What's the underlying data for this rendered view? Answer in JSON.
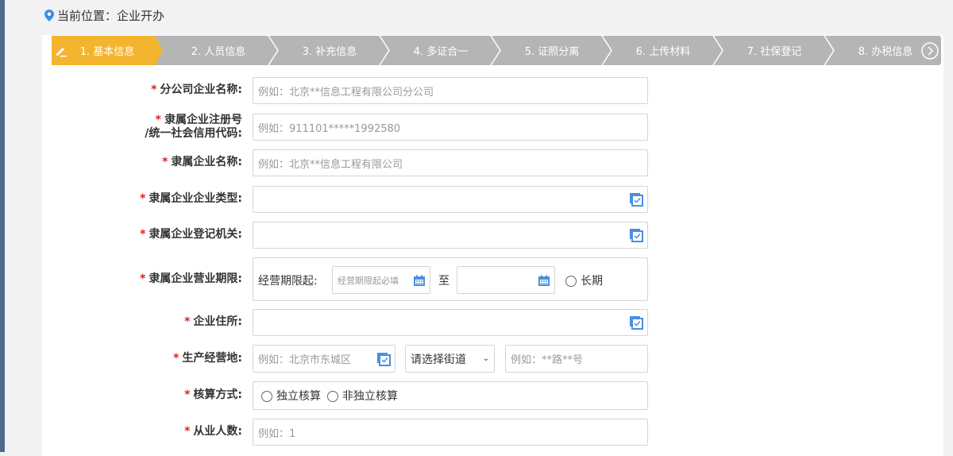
{
  "breadcrumb": {
    "text": "当前位置：企业开办"
  },
  "steps": [
    "1. 基本信息",
    "2. 人员信息",
    "3. 补充信息",
    "4. 多证合一",
    "5. 证照分离",
    "6. 上传材料",
    "7. 社保登记",
    "8. 办税信息"
  ],
  "form": {
    "branch_name": {
      "label": "分公司企业名称:",
      "placeholder": "例如：北京**信息工程有限公司分公司"
    },
    "parent_reg": {
      "label1": "隶属企业注册号",
      "label2": "/统一社会信用代码:",
      "placeholder": "例如：911101*****1992580"
    },
    "parent_name": {
      "label": "隶属企业名称:",
      "placeholder": "例如：北京**信息工程有限公司"
    },
    "parent_type": {
      "label": "隶属企业企业类型:"
    },
    "parent_authority": {
      "label": "隶属企业登记机关:"
    },
    "parent_term": {
      "label": "隶属企业营业期限:",
      "start_label": "经营期限起:",
      "start_placeholder": "经营期限起必填",
      "to": "至",
      "long_term": "长期"
    },
    "address": {
      "label": "企业住所:"
    },
    "op_address": {
      "label": "生产经营地:",
      "district_placeholder": "例如：北京市东城区",
      "street_select": "请选择街道",
      "detail_placeholder": "例如：**路**号"
    },
    "accounting": {
      "label": "核算方式:",
      "options": [
        "独立核算",
        "非独立核算"
      ]
    },
    "employees": {
      "label": "从业人数:",
      "placeholder": "例如：1"
    }
  },
  "required_mark": "*"
}
